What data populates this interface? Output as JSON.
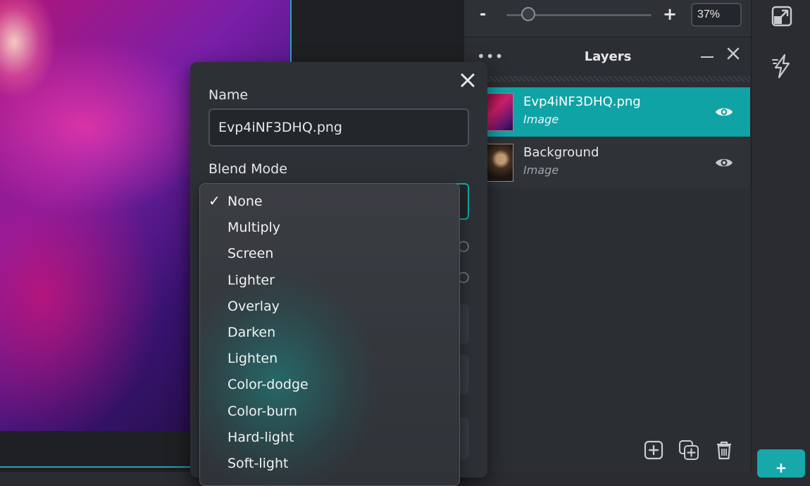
{
  "zoom": {
    "minus": "-",
    "plus": "+",
    "value": "37%",
    "level": 0.15
  },
  "layers_panel": {
    "title": "Layers",
    "menu_dots": "•••",
    "layers": [
      {
        "name": "Evp4iNF3DHQ.png",
        "type": "Image",
        "active": true
      },
      {
        "name": "Background",
        "type": "Image",
        "active": false
      }
    ]
  },
  "dialog": {
    "name_label": "Name",
    "name_value": "Evp4iNF3DHQ.png",
    "blend_label": "Blend Mode"
  },
  "blend_modes": {
    "selected": "None",
    "check": "✓",
    "options": [
      "None",
      "Multiply",
      "Screen",
      "Lighter",
      "Overlay",
      "Darken",
      "Lighten",
      "Color-dodge",
      "Color-burn",
      "Hard-light",
      "Soft-light"
    ]
  },
  "toolbar": {
    "action_glyph": "+"
  },
  "colors": {
    "accent": "#10a3a5",
    "panel": "#2b2e33",
    "dialog": "#2d3136"
  }
}
